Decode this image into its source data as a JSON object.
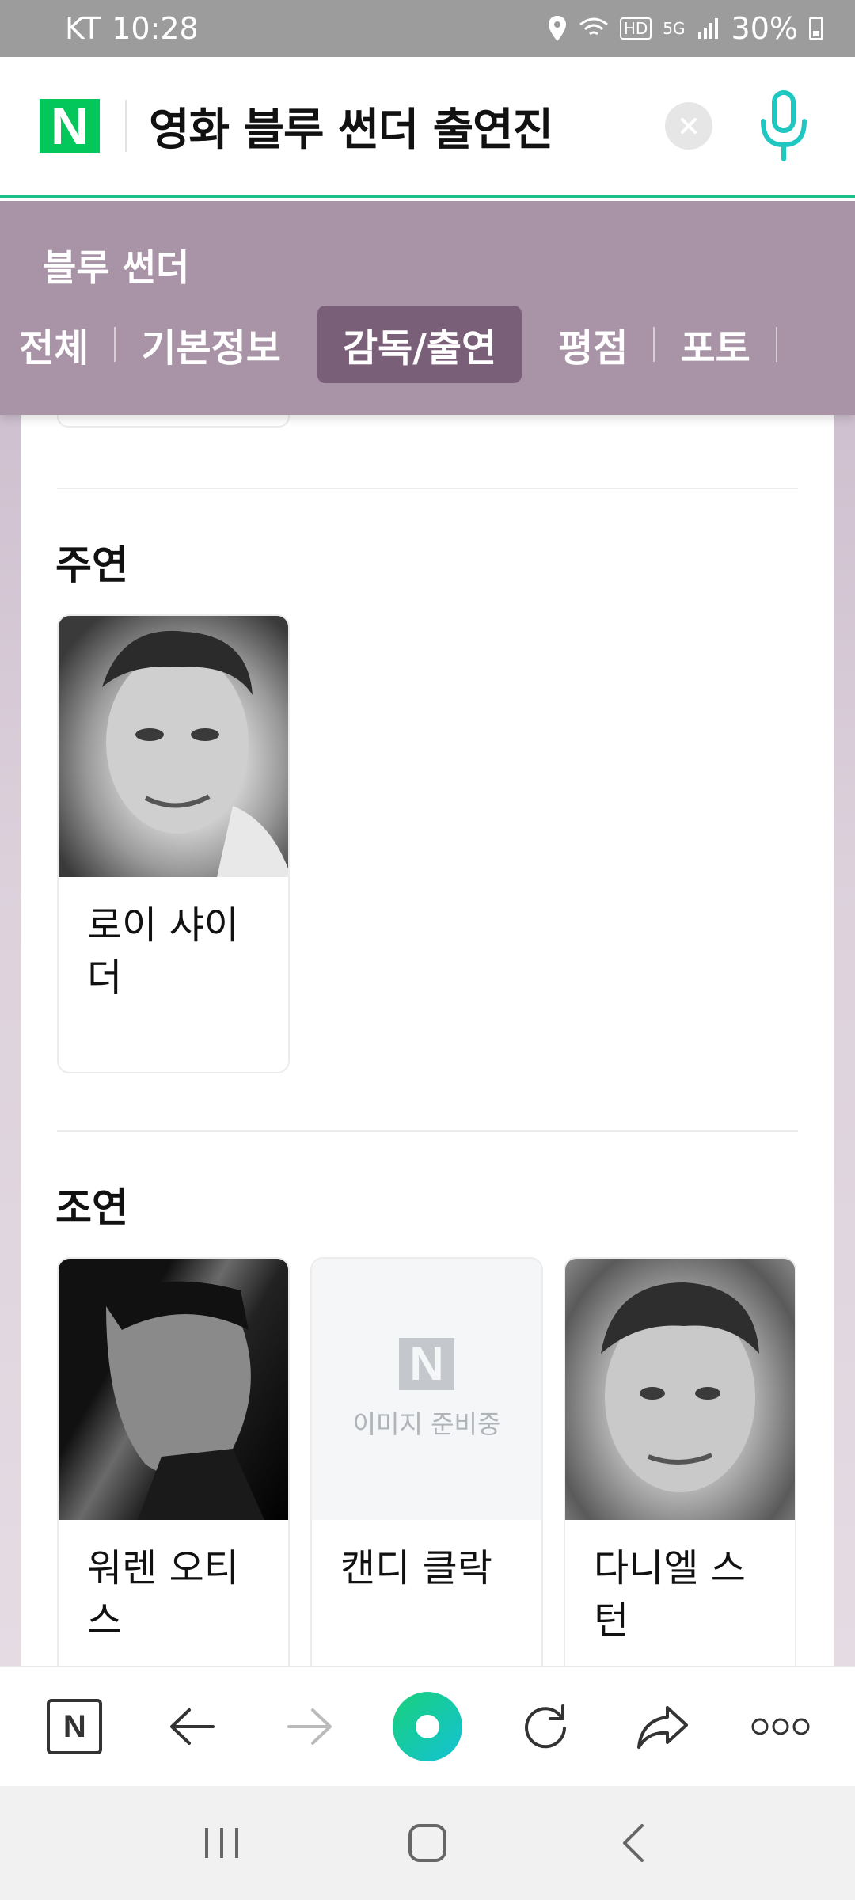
{
  "status_bar": {
    "carrier": "KT",
    "time": "10:28",
    "network": "HD",
    "network_type": "5G",
    "battery": "30%"
  },
  "search": {
    "logo": "N",
    "query": "영화 블루 썬더 출연진"
  },
  "movie": {
    "title": "블루 썬더",
    "tabs": [
      {
        "label": "전체"
      },
      {
        "label": "기본정보"
      },
      {
        "label": "감독/출연"
      },
      {
        "label": "평점"
      },
      {
        "label": "포토"
      }
    ],
    "active_tab": "감독/출연"
  },
  "sections": {
    "lead": {
      "title": "주연",
      "people": [
        {
          "name": "로이 샤이더"
        }
      ]
    },
    "supporting": {
      "title": "조연",
      "people": [
        {
          "name": "워렌 오티스"
        },
        {
          "name": "캔디 클락",
          "photo_placeholder": {
            "logo": "N",
            "text": "이미지 준비중"
          }
        },
        {
          "name": "다니엘 스턴"
        }
      ]
    }
  },
  "browser_bar": {
    "home_logo": "N",
    "icons": [
      "naver-home-icon",
      "back-icon",
      "forward-icon",
      "green-dot-icon",
      "refresh-icon",
      "share-icon",
      "more-icon"
    ]
  },
  "colors": {
    "naver_green": "#03c75a",
    "header_purple": "#a893a7",
    "active_tab": "#7a5f79",
    "mic_teal": "#1fc7c1"
  }
}
